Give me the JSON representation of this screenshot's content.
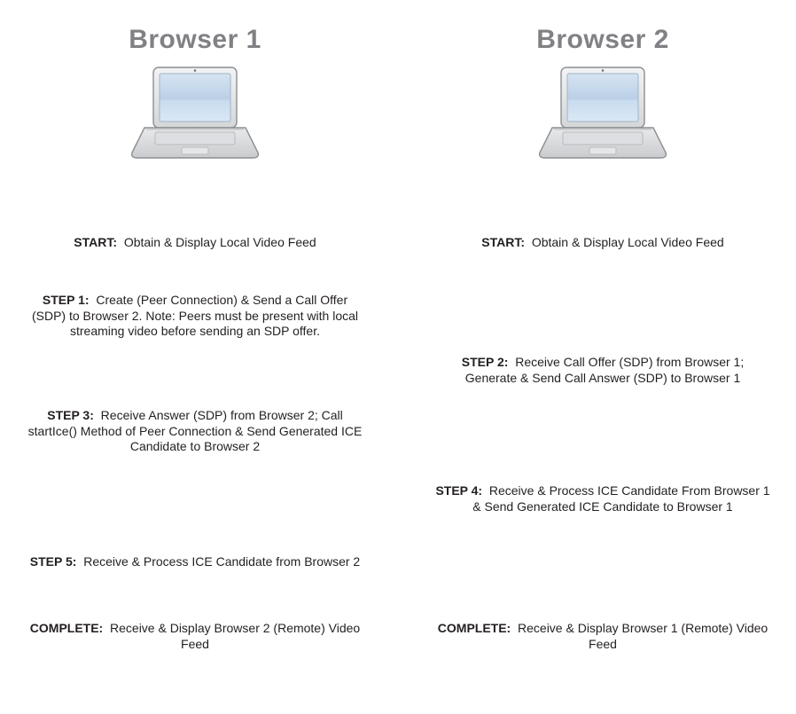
{
  "browser1": {
    "title": "Browser 1",
    "start": {
      "label": "START:",
      "text": "Obtain & Display Local Video Feed"
    },
    "step1": {
      "label": "STEP 1:",
      "text": "Create (Peer Connection) & Send a Call Offer (SDP) to Browser 2. Note: Peers must be present with local streaming video before sending an SDP offer."
    },
    "step3": {
      "label": "STEP 3:",
      "text": "Receive Answer (SDP) from Browser 2; Call startIce() Method of Peer Connection & Send Generated ICE Candidate to Browser 2"
    },
    "step5": {
      "label": "STEP 5:",
      "text": "Receive & Process ICE Candidate from Browser 2"
    },
    "complete": {
      "label": "COMPLETE:",
      "text": "Receive & Display Browser 2 (Remote) Video Feed"
    }
  },
  "browser2": {
    "title": "Browser 2",
    "start": {
      "label": "START:",
      "text": "Obtain & Display Local Video Feed"
    },
    "step2": {
      "label": "STEP 2:",
      "text": "Receive Call Offer (SDP) from Browser 1; Generate & Send Call Answer (SDP) to Browser 1"
    },
    "step4": {
      "label": "STEP 4:",
      "text": "Receive & Process ICE Candidate From Browser 1 & Send Generated ICE Candidate to Browser 1"
    },
    "complete": {
      "label": "COMPLETE:",
      "text": "Receive & Display Browser 1 (Remote) Video Feed"
    }
  }
}
